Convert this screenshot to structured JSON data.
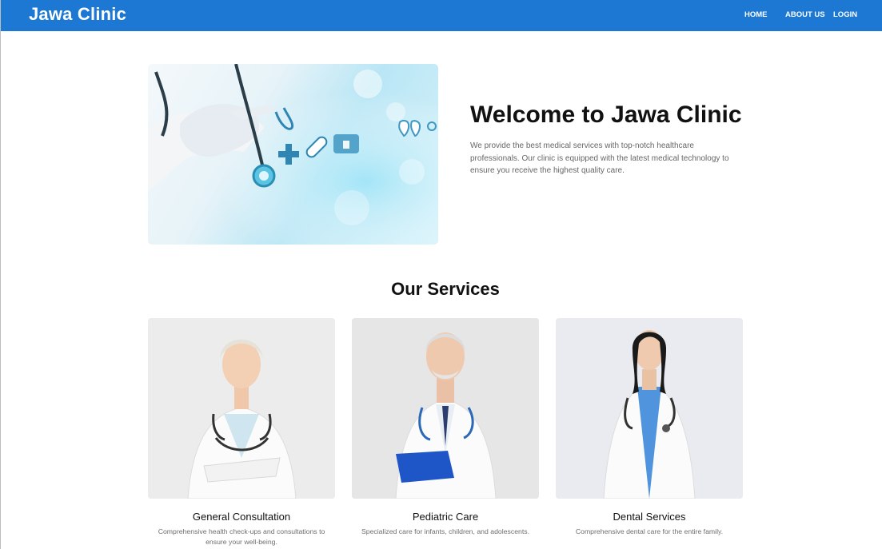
{
  "header": {
    "brand": "Jawa Clinic",
    "nav": [
      {
        "label": "HOME"
      },
      {
        "label": "ABOUT US"
      },
      {
        "label": "LOGIN"
      }
    ]
  },
  "hero": {
    "title": "Welcome to Jawa Clinic",
    "description": "We provide the best medical services with top-notch healthcare professionals. Our clinic is equipped with the latest medical technology to ensure you receive the highest quality care.",
    "image_icon": "medical-technology-photo"
  },
  "services": {
    "title": "Our Services",
    "items": [
      {
        "title": "General Consultation",
        "description": "Comprehensive health check-ups and consultations to ensure your well-being."
      },
      {
        "title": "Pediatric Care",
        "description": "Specialized care for infants, children, and adolescents."
      },
      {
        "title": "Dental Services",
        "description": "Comprehensive dental care for the entire family."
      }
    ]
  },
  "colors": {
    "navbar": "#1c78d2",
    "text_muted": "#666666"
  }
}
